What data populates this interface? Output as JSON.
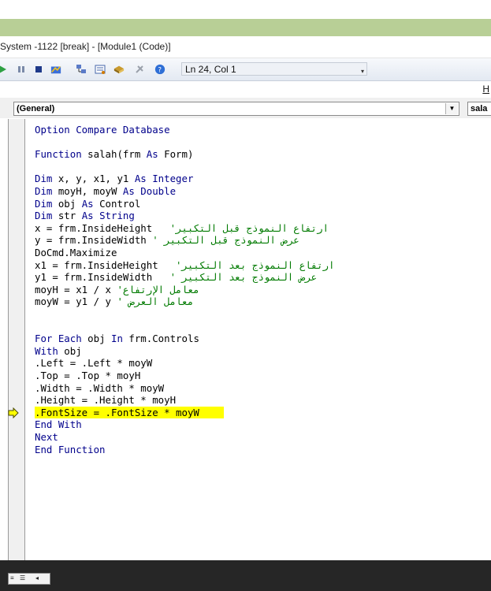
{
  "window": {
    "title": "System -1122 [break] - [Module1 (Code)]"
  },
  "toolbar": {
    "cursor_position": "Ln 24, Col 1",
    "icons": [
      "run-icon",
      "break-icon",
      "reset-icon",
      "design-mode-icon",
      "project-explorer-icon",
      "properties-icon",
      "object-browser-icon",
      "toolbox-icon",
      "help-icon"
    ]
  },
  "help_menu": {
    "label": "H"
  },
  "selector": {
    "object_value": "(General)",
    "procedure_value": "sala"
  },
  "code": {
    "lines": [
      {
        "kw1": "Option Compare Database"
      },
      {
        "blank": true
      },
      {
        "kw1": "Function",
        "txt": " salah(frm ",
        "kw2": "As",
        "txt2": " Form)"
      },
      {
        "blank": true
      },
      {
        "kw1": "Dim",
        "txt": " x, y, x1, y1 ",
        "kw2": "As Integer"
      },
      {
        "kw1": "Dim",
        "txt": " moyH, moyW ",
        "kw2": "As Double"
      },
      {
        "kw1": "Dim",
        "txt": " obj ",
        "kw2": "As",
        "txt2": " Control"
      },
      {
        "kw1": "Dim",
        "txt": " str ",
        "kw2": "As String"
      },
      {
        "txt": "x = frm.InsideHeight  ",
        "cmt": " 'ارتفاع النموذج قبل التكبير"
      },
      {
        "txt": "y = frm.InsideWidth ",
        "cmt": "' عرض النموذج قبل التكبير"
      },
      {
        "txt": "DoCmd.Maximize"
      },
      {
        "txt": "x1 = frm.InsideHeight  ",
        "cmt": " 'ارتفاع النموذج بعد التكبير"
      },
      {
        "txt": "y1 = frm.InsideWidth  ",
        "cmt": " ' عرض النموذج بعد التكبير"
      },
      {
        "txt": "moyH = x1 / x ",
        "cmt": "'معامل الإرتفاع"
      },
      {
        "txt": "moyW = y1 / y ",
        "cmt": "' معامل العرض"
      },
      {
        "blank": true
      },
      {
        "blank": true
      },
      {
        "kw1": "For Each",
        "txt": " obj ",
        "kw2": "In",
        "txt2": " frm.Controls"
      },
      {
        "kw1": "With",
        "txt": " obj"
      },
      {
        "txt": ".Left = .Left * moyW"
      },
      {
        "txt": ".Top = .Top * moyH"
      },
      {
        "txt": ".Width = .Width * moyW"
      },
      {
        "txt": ".Height = .Height * moyH"
      },
      {
        "txt": ".FontSize = .FontSize * moyW",
        "current": true
      },
      {
        "kw1": "End With"
      },
      {
        "kw1": "Next"
      },
      {
        "kw1": "End Function"
      }
    ]
  },
  "colors": {
    "keyword": "#00008b",
    "comment": "#007a00",
    "execution_highlight": "#ffff00",
    "title_band": "#b8cf96"
  }
}
